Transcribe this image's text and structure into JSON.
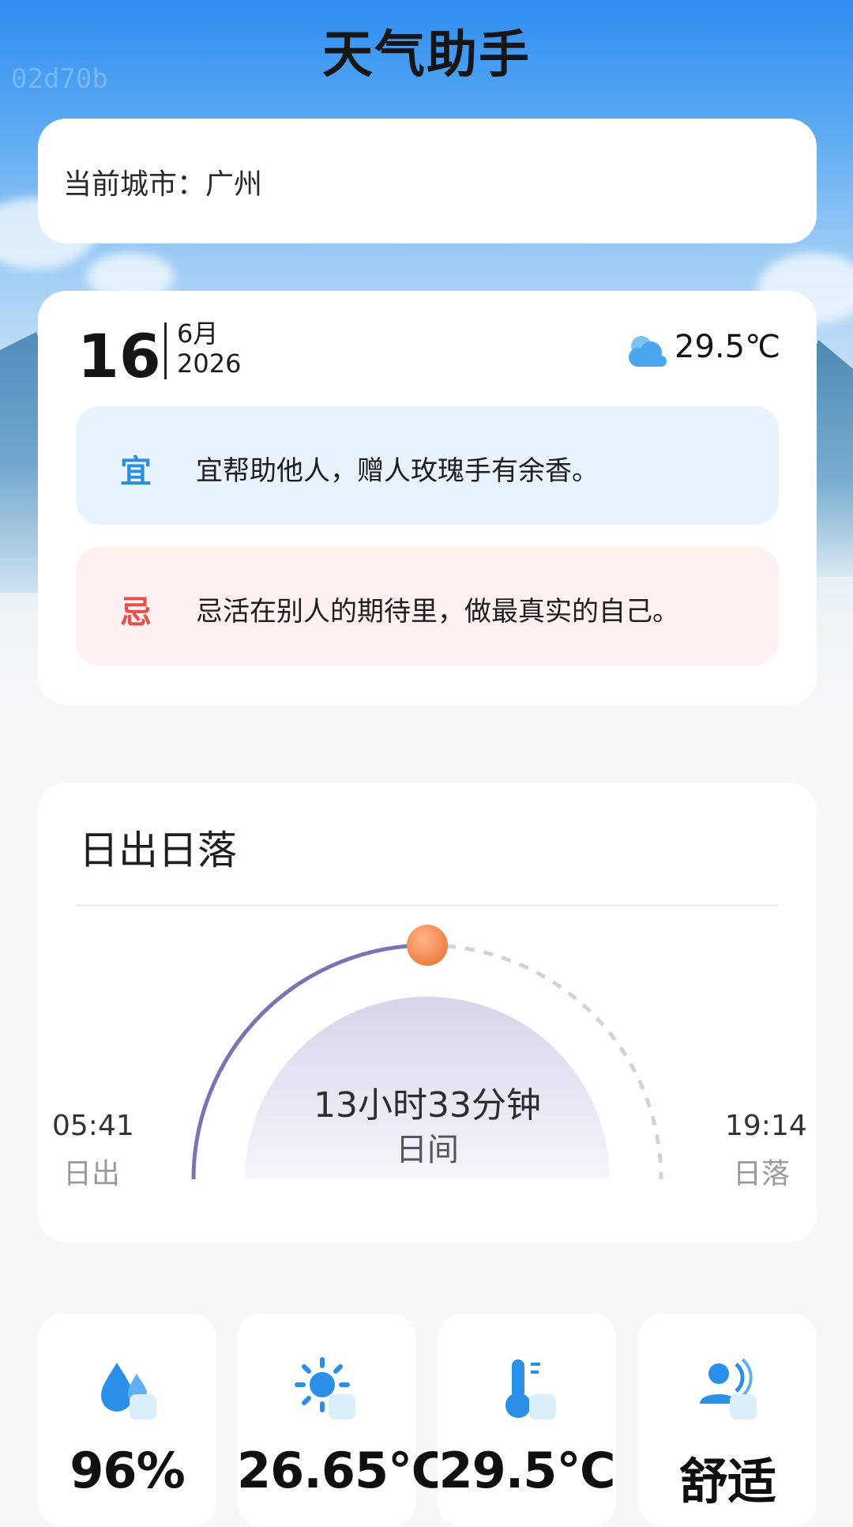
{
  "app": {
    "title": "天气助手",
    "watermark": "02d70b"
  },
  "city": {
    "text": "当前城市：广州"
  },
  "date": {
    "day": "16",
    "month": "6月",
    "year": "2026"
  },
  "weather": {
    "icon": "cloud-sun-icon",
    "temperature": "29.5℃"
  },
  "almanac": {
    "yi_tag": "宜",
    "yi_text": "宜帮助他人，赠人玫瑰手有余香。",
    "ji_tag": "忌",
    "ji_text": "忌活在别人的期待里，做最真实的自己。"
  },
  "sun": {
    "title": "日出日落",
    "duration": "13小时33分钟",
    "duration_label": "日间",
    "sunrise_time": "05:41",
    "sunrise_label": "日出",
    "sunset_time": "19:14",
    "sunset_label": "日落",
    "day_progress": 0.5
  },
  "stats": [
    {
      "icon": "humidity-icon",
      "value": "96%"
    },
    {
      "icon": "sun-icon",
      "value": "26.65℃"
    },
    {
      "icon": "thermometer-icon",
      "value": "29.5℃"
    },
    {
      "icon": "comfort-icon",
      "value": "舒适"
    }
  ],
  "colors": {
    "yi": "#2b8fe0",
    "ji": "#e6504a",
    "arc": "#7b73b4",
    "sun": "#f2874e",
    "icon_blue": "#2a8fe6"
  }
}
